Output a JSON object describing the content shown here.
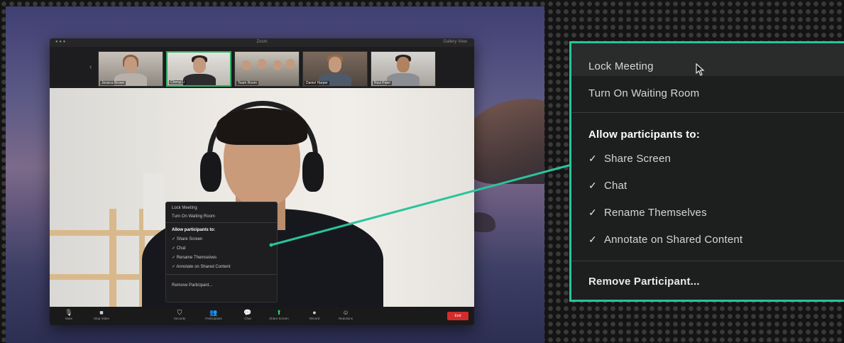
{
  "zoom_window": {
    "title": "Zoom",
    "view_label": "Gallery View",
    "participants": [
      {
        "name": "Jessica Brown"
      },
      {
        "name": "Cheng Li"
      },
      {
        "name": "Team Room"
      },
      {
        "name": "Daniel Harper"
      },
      {
        "name": "Ravi Patel"
      }
    ],
    "toolbar": {
      "mute": "Mute",
      "stop_video": "Stop Video",
      "security": "Security",
      "participants": "Participants",
      "chat": "Chat",
      "share_screen": "Share Screen",
      "record": "Record",
      "reactions": "Reactions",
      "end": "End"
    }
  },
  "security_menu": {
    "lock_meeting": "Lock Meeting",
    "waiting_room": "Turn On Waiting Room",
    "allow_header": "Allow participants to:",
    "allow_items": [
      {
        "label": "Share Screen",
        "checked": true
      },
      {
        "label": "Chat",
        "checked": true
      },
      {
        "label": "Rename Themselves",
        "checked": true
      },
      {
        "label": "Annotate on Shared Content",
        "checked": true
      }
    ],
    "remove_participant": "Remove Participant..."
  },
  "colors": {
    "accent_teal": "#2bc39b",
    "active_speaker_green": "#2fb060",
    "end_red": "#d42b2b"
  }
}
